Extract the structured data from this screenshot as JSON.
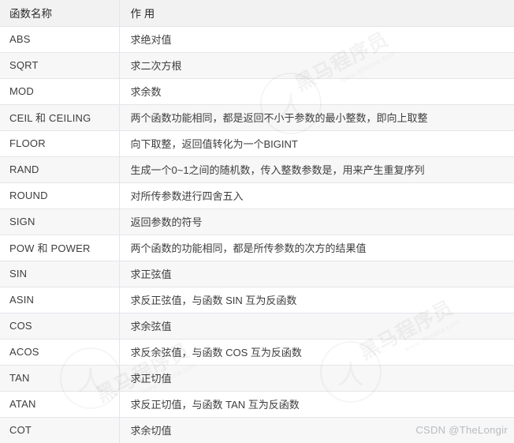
{
  "table": {
    "columns": [
      {
        "key": "name",
        "label": "函数名称"
      },
      {
        "key": "desc",
        "label": "作 用"
      }
    ],
    "rows": [
      {
        "name": "ABS",
        "desc": "求绝对值"
      },
      {
        "name": "SQRT",
        "desc": "求二次方根"
      },
      {
        "name": "MOD",
        "desc": "求余数"
      },
      {
        "name": "CEIL 和 CEILING",
        "desc": "两个函数功能相同，都是返回不小于参数的最小整数，即向上取整"
      },
      {
        "name": "FLOOR",
        "desc": "向下取整，返回值转化为一个BIGINT"
      },
      {
        "name": "RAND",
        "desc": "生成一个0~1之间的随机数，传入整数参数是，用来产生重复序列"
      },
      {
        "name": "ROUND",
        "desc": "对所传参数进行四舍五入"
      },
      {
        "name": "SIGN",
        "desc": "返回参数的符号"
      },
      {
        "name": "POW 和 POWER",
        "desc": "两个函数的功能相同，都是所传参数的次方的结果值"
      },
      {
        "name": "SIN",
        "desc": "求正弦值"
      },
      {
        "name": "ASIN",
        "desc": "求反正弦值，与函数 SIN 互为反函数"
      },
      {
        "name": "COS",
        "desc": "求余弦值"
      },
      {
        "name": "ACOS",
        "desc": "求反余弦值，与函数 COS 互为反函数"
      },
      {
        "name": "TAN",
        "desc": "求正切值"
      },
      {
        "name": "ATAN",
        "desc": "求反正切值，与函数 TAN 互为反函数"
      },
      {
        "name": "COT",
        "desc": "求余切值"
      }
    ]
  },
  "credit": {
    "text": "CSDN @TheLongir"
  },
  "watermark": {
    "brand": "黑马程序员",
    "url": "www.itheima.com"
  },
  "colors": {
    "header_bg": "#f2f2f2",
    "row_odd_bg": "#ffffff",
    "row_even_bg": "#f7f7f7",
    "border": "#e3e6ea",
    "text": "#3d3d3d",
    "header_text": "#2b2b2b",
    "credit_text": "#b8bcc0"
  }
}
